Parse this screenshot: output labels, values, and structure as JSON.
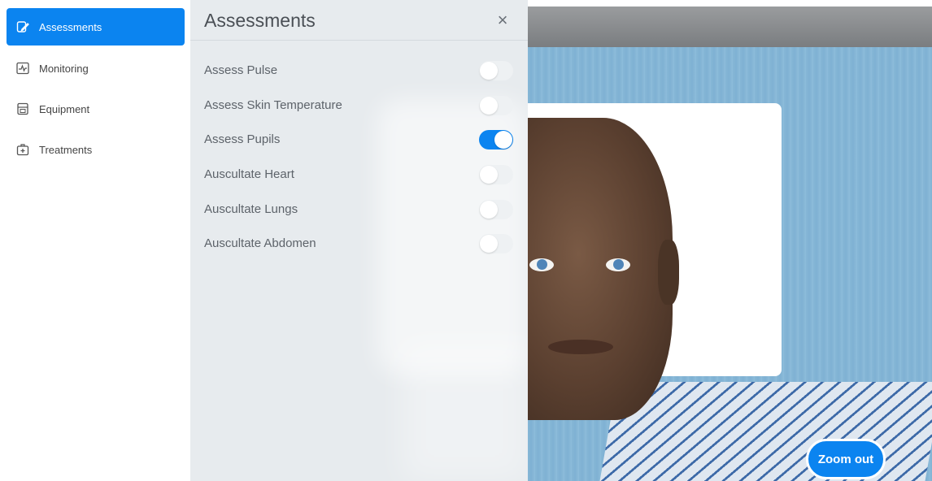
{
  "sidebar": {
    "items": [
      {
        "label": "Assessments",
        "icon": "clipboard-edit-icon",
        "active": true
      },
      {
        "label": "Monitoring",
        "icon": "monitor-pulse-icon",
        "active": false
      },
      {
        "label": "Equipment",
        "icon": "equipment-case-icon",
        "active": false
      },
      {
        "label": "Treatments",
        "icon": "first-aid-kit-icon",
        "active": false
      }
    ]
  },
  "panel": {
    "title": "Assessments",
    "close_label": "×",
    "rows": [
      {
        "label": "Assess Pulse",
        "on": false
      },
      {
        "label": "Assess Skin Temperature",
        "on": false
      },
      {
        "label": "Assess Pupils",
        "on": true
      },
      {
        "label": "Auscultate Heart",
        "on": false
      },
      {
        "label": "Auscultate Lungs",
        "on": false
      },
      {
        "label": "Auscultate Abdomen",
        "on": false
      }
    ]
  },
  "scene": {
    "zoom_label": "Zoom out"
  },
  "colors": {
    "accent": "#0b84f0",
    "panel_bg": "#e7ebee",
    "wall": "#86b7d6"
  }
}
